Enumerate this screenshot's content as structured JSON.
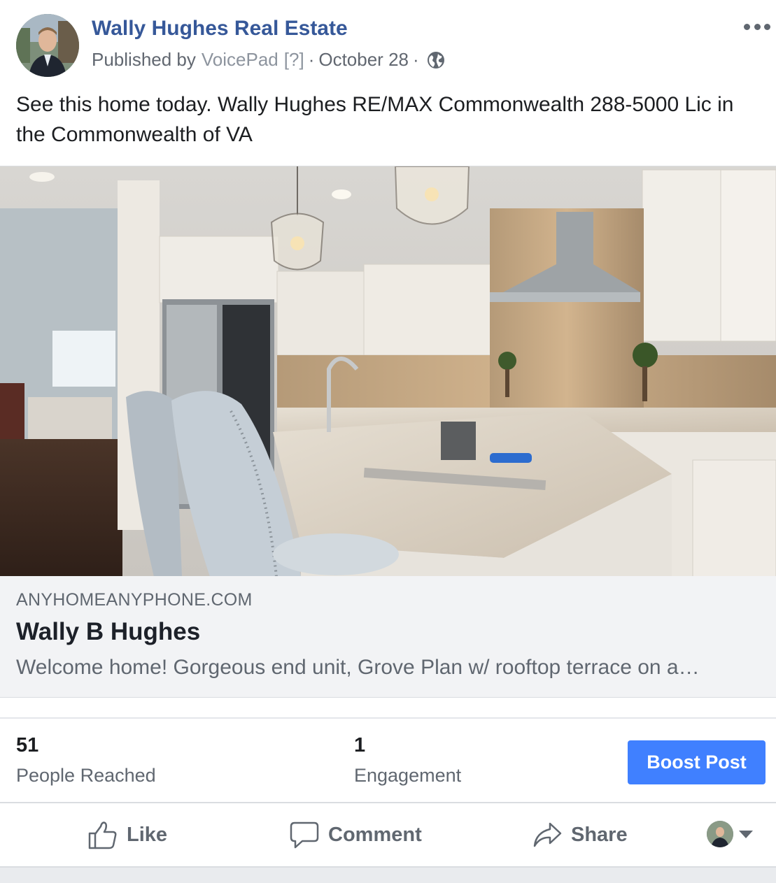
{
  "header": {
    "page_name": "Wally Hughes Real Estate",
    "published_by_prefix": "Published by",
    "publisher": "VoicePad",
    "help": "[?]",
    "separator": "·",
    "date": "October 28",
    "audience_icon": "globe-icon",
    "menu_icon": "more-options-icon"
  },
  "message": "See this home today. Wally Hughes RE/MAX Commonwealth 288-5000 Lic in the Commonwealth of VA",
  "link_preview": {
    "domain": "ANYHOMEANYPHONE.COM",
    "title": "Wally B Hughes",
    "description": "Welcome home! Gorgeous end unit, Grove Plan w/ rooftop terrace on a…"
  },
  "insights": {
    "people_reached": {
      "value": "51",
      "label": "People Reached"
    },
    "engagement": {
      "value": "1",
      "label": "Engagement"
    },
    "boost_label": "Boost Post"
  },
  "actions": {
    "like": "Like",
    "comment": "Comment",
    "share": "Share"
  },
  "colors": {
    "page_name": "#365899",
    "boost_button": "#4080ff",
    "muted_text": "#606770",
    "link_background": "#f2f3f5"
  }
}
